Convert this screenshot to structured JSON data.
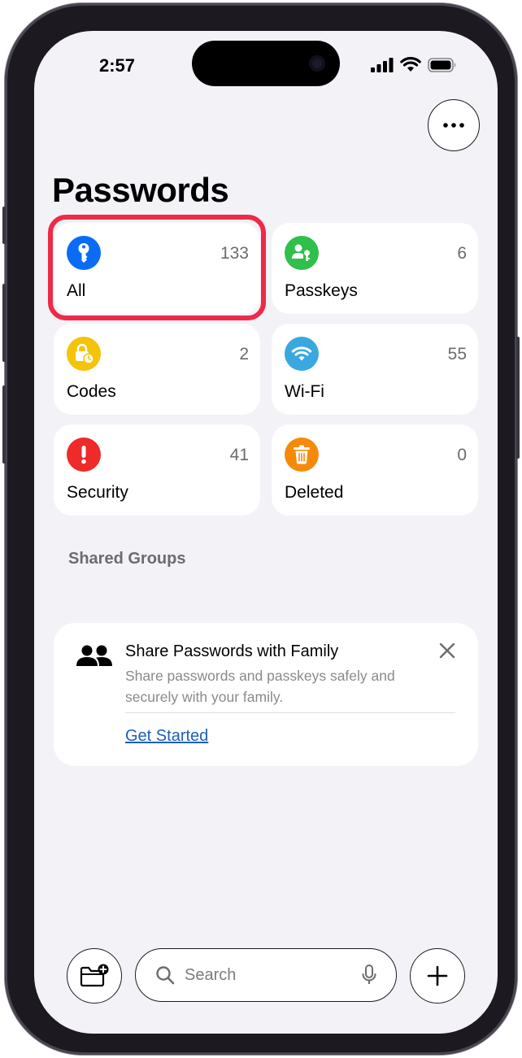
{
  "status_bar": {
    "time": "2:57"
  },
  "header": {
    "title": "Passwords"
  },
  "categories": [
    {
      "label": "All",
      "count": "133",
      "color": "#0a6cf5",
      "icon": "key-icon"
    },
    {
      "label": "Passkeys",
      "count": "6",
      "color": "#2fbf4a",
      "icon": "person-key-icon"
    },
    {
      "label": "Codes",
      "count": "2",
      "color": "#f5c30a",
      "icon": "lock-clock-icon"
    },
    {
      "label": "Wi-Fi",
      "count": "55",
      "color": "#3aa8e0",
      "icon": "wifi-icon"
    },
    {
      "label": "Security",
      "count": "41",
      "color": "#ee2a2a",
      "icon": "exclamation-icon"
    },
    {
      "label": "Deleted",
      "count": "0",
      "color": "#f58a0a",
      "icon": "trash-icon"
    }
  ],
  "shared_groups": {
    "section_title": "Shared Groups",
    "card": {
      "heading": "Share Passwords with Family",
      "description": "Share passwords and passkeys safely and securely with your family.",
      "link": "Get Started"
    }
  },
  "bottom_bar": {
    "search_placeholder": "Search"
  },
  "colors": {
    "highlight": "#ee2a48",
    "link": "#1d5fb8",
    "background": "#f2f2f7"
  }
}
